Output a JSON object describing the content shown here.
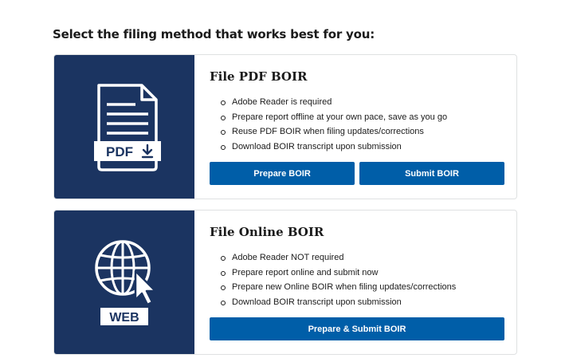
{
  "heading": "Select the filing method that works best for you:",
  "pdf_option": {
    "title": "File PDF BOIR",
    "icon_label": "PDF",
    "icon": "pdf-document-icon",
    "bullets": [
      "Adobe Reader is required",
      "Prepare report offline at your own pace, save as you go",
      "Reuse PDF BOIR when filing updates/corrections",
      "Download BOIR transcript upon submission"
    ],
    "prepare_label": "Prepare BOIR",
    "submit_label": "Submit BOIR"
  },
  "web_option": {
    "title": "File Online BOIR",
    "icon_label": "WEB",
    "icon": "globe-cursor-icon",
    "bullets": [
      "Adobe Reader NOT required",
      "Prepare report online and submit now",
      "Prepare new Online BOIR when filing updates/corrections",
      "Download BOIR transcript upon submission"
    ],
    "prepare_submit_label": "Prepare & Submit BOIR"
  },
  "colors": {
    "panel": "#1b3461",
    "button": "#005ea8",
    "card_border": "#dfe1e2"
  }
}
